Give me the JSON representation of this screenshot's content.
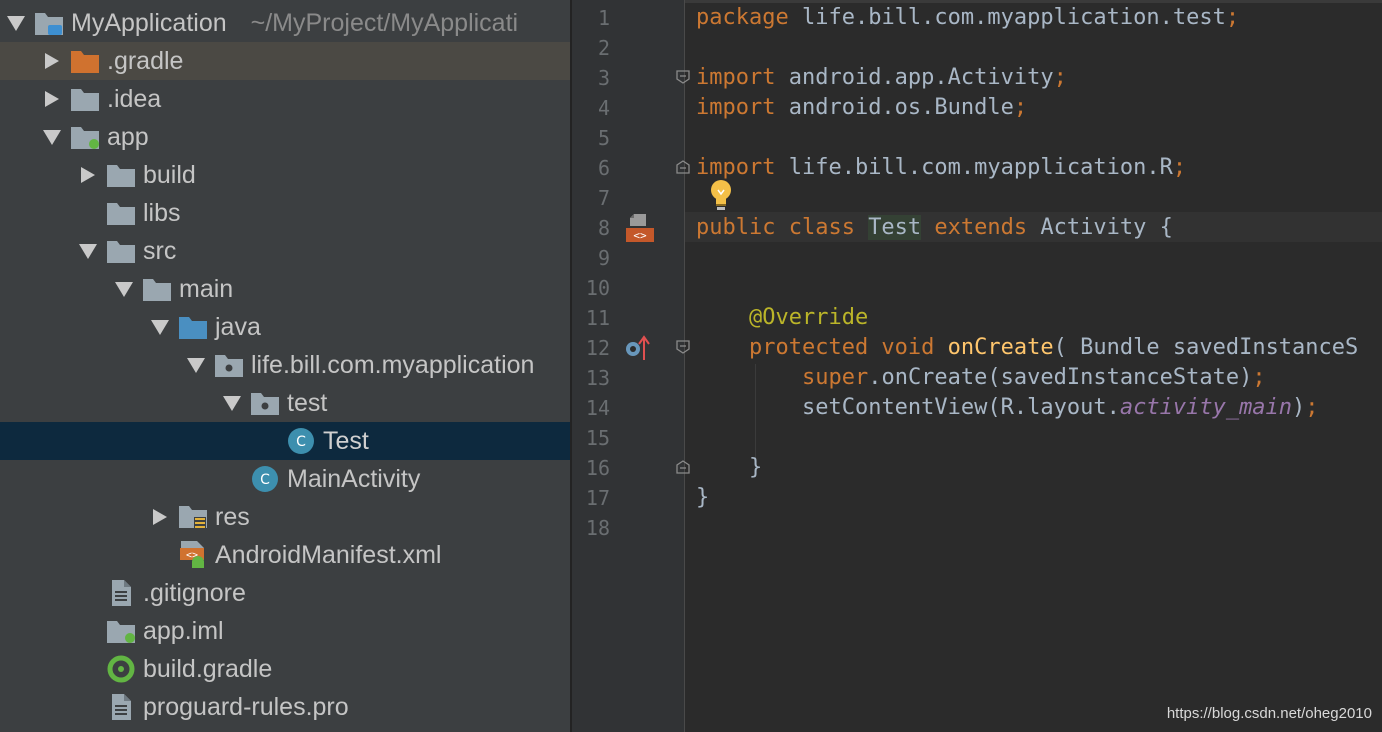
{
  "project_tree": {
    "items": [
      {
        "label": "MyApplication",
        "path": "~/MyProject/MyApplicati",
        "depth": 0,
        "expanded": "down",
        "icon": "module-folder-icon"
      },
      {
        "label": ".gradle",
        "depth": 1,
        "expanded": "right",
        "icon": "orange-folder-icon"
      },
      {
        "label": ".idea",
        "depth": 1,
        "expanded": "right",
        "icon": "folder-icon"
      },
      {
        "label": "app",
        "depth": 1,
        "expanded": "down",
        "icon": "android-module-folder-icon"
      },
      {
        "label": "build",
        "depth": 2,
        "expanded": "right",
        "icon": "folder-icon"
      },
      {
        "label": "libs",
        "depth": 2,
        "expanded": "none",
        "icon": "folder-icon"
      },
      {
        "label": "src",
        "depth": 2,
        "expanded": "down",
        "icon": "folder-icon"
      },
      {
        "label": "main",
        "depth": 3,
        "expanded": "down",
        "icon": "folder-icon"
      },
      {
        "label": "java",
        "depth": 4,
        "expanded": "down",
        "icon": "source-folder-icon"
      },
      {
        "label": "life.bill.com.myapplication",
        "depth": 5,
        "expanded": "down",
        "icon": "package-icon"
      },
      {
        "label": "test",
        "depth": 6,
        "expanded": "down",
        "icon": "package-icon"
      },
      {
        "label": "Test",
        "depth": 7,
        "expanded": "none",
        "icon": "java-class-icon"
      },
      {
        "label": "MainActivity",
        "depth": 6,
        "expanded": "none",
        "icon": "java-class-icon"
      },
      {
        "label": "res",
        "depth": 4,
        "expanded": "right",
        "icon": "resource-folder-icon"
      },
      {
        "label": "AndroidManifest.xml",
        "depth": 4,
        "expanded": "none",
        "icon": "manifest-file-icon"
      },
      {
        "label": ".gitignore",
        "depth": 2,
        "expanded": "none",
        "icon": "text-file-icon"
      },
      {
        "label": "app.iml",
        "depth": 2,
        "expanded": "none",
        "icon": "iml-file-icon"
      },
      {
        "label": "build.gradle",
        "depth": 2,
        "expanded": "none",
        "icon": "gradle-file-icon"
      },
      {
        "label": "proguard-rules.pro",
        "depth": 2,
        "expanded": "none",
        "icon": "text-file-icon"
      }
    ],
    "hover_index": 1,
    "selected_index": 11
  },
  "editor": {
    "line_numbers": [
      "1",
      "2",
      "3",
      "4",
      "5",
      "6",
      "7",
      "8",
      "9",
      "10",
      "11",
      "12",
      "13",
      "14",
      "15",
      "16",
      "17",
      "18"
    ],
    "lines": [
      [
        {
          "t": "package ",
          "c": "kw"
        },
        {
          "t": "life.bill.com.myapplication.test"
        },
        {
          "t": ";",
          "c": "kw"
        }
      ],
      [],
      [
        {
          "t": "import ",
          "c": "kw"
        },
        {
          "t": "android.app.Activity"
        },
        {
          "t": ";",
          "c": "kw"
        }
      ],
      [
        {
          "t": "import ",
          "c": "kw"
        },
        {
          "t": "android.os.Bundle"
        },
        {
          "t": ";",
          "c": "kw"
        }
      ],
      [],
      [
        {
          "t": "import ",
          "c": "kw"
        },
        {
          "t": "life.bill.com.myapplication.R"
        },
        {
          "t": ";",
          "c": "kw"
        }
      ],
      [],
      [
        {
          "t": "public class ",
          "c": "kw"
        },
        {
          "t": "Test",
          "c": "hl"
        },
        {
          "t": " "
        },
        {
          "t": "extends ",
          "c": "kw"
        },
        {
          "t": "Activity {"
        }
      ],
      [],
      [],
      [
        {
          "t": "    "
        },
        {
          "t": "@Override",
          "c": "ann"
        }
      ],
      [
        {
          "t": "    "
        },
        {
          "t": "protected void ",
          "c": "kw"
        },
        {
          "t": "onCreate",
          "c": "mth"
        },
        {
          "t": "( Bundle savedInstanceS"
        }
      ],
      [
        {
          "t": "        "
        },
        {
          "t": "super",
          "c": "kw"
        },
        {
          "t": ".onCreate(savedInstanceState)"
        },
        {
          "t": ";",
          "c": "kw"
        }
      ],
      [
        {
          "t": "        "
        },
        {
          "t": "setContentView(R.layout."
        },
        {
          "t": "activity_main",
          "c": "fld"
        },
        {
          "t": ")"
        },
        {
          "t": ";",
          "c": "kw"
        }
      ],
      [],
      [
        {
          "t": "    }"
        }
      ],
      [
        {
          "t": "}"
        }
      ],
      []
    ]
  },
  "watermark": "https://blog.csdn.net/oheg2010",
  "colors": {
    "keyword": "#cc7832",
    "annotation": "#bbb529",
    "method": "#ffc66d",
    "field": "#9876aa",
    "default": "#a9b7c6"
  }
}
